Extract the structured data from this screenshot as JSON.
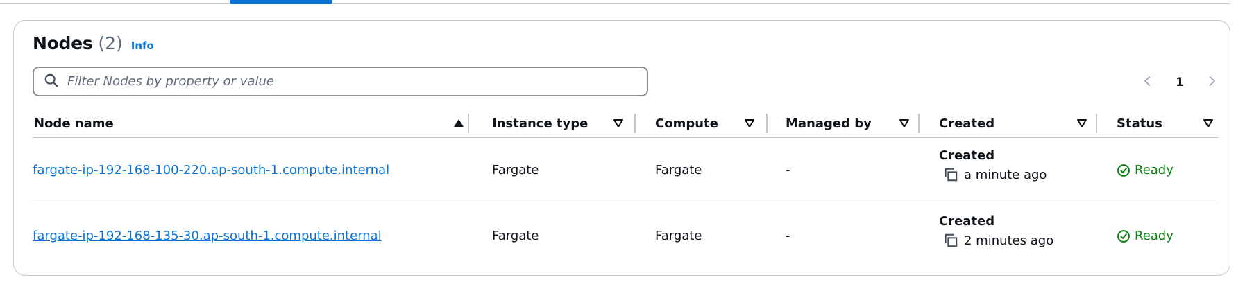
{
  "panel": {
    "title": "Nodes",
    "count": "(2)",
    "info_label": "Info"
  },
  "search": {
    "placeholder": "Filter Nodes by property or value",
    "value": ""
  },
  "pagination": {
    "current_page": "1"
  },
  "columns": [
    {
      "label": "Node name",
      "sort": "ascending"
    },
    {
      "label": "Instance type",
      "sort": "none"
    },
    {
      "label": "Compute",
      "sort": "none"
    },
    {
      "label": "Managed by",
      "sort": "none"
    },
    {
      "label": "Created",
      "sort": "none"
    },
    {
      "label": "Status",
      "sort": "none"
    }
  ],
  "rows": [
    {
      "node_name": "fargate-ip-192-168-100-220.ap-south-1.compute.internal",
      "instance_type": "Fargate",
      "compute": "Fargate",
      "managed_by": "-",
      "created_label": "Created",
      "created_time": "a minute ago",
      "status": "Ready"
    },
    {
      "node_name": "fargate-ip-192-168-135-30.ap-south-1.compute.internal",
      "instance_type": "Fargate",
      "compute": "Fargate",
      "managed_by": "-",
      "created_label": "Created",
      "created_time": "2 minutes ago",
      "status": "Ready"
    }
  ],
  "icons": {
    "search": "search-icon",
    "prev": "chevron-left-icon",
    "next": "chevron-right-icon",
    "sort_asc": "sort-ascending-icon",
    "sort_none": "sort-descending-outline-icon",
    "copy": "copy-icon",
    "status_ok": "status-success-icon"
  },
  "colors": {
    "link": "#0972d3",
    "success": "#037f0c",
    "text": "#0f141a",
    "muted": "#5f6b7a",
    "border": "#c6c6cd"
  }
}
